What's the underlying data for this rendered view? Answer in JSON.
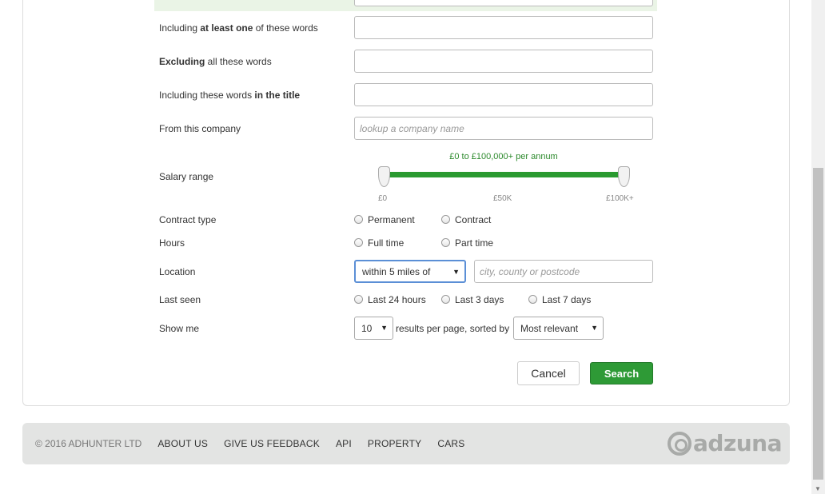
{
  "form": {
    "at_least_one": {
      "prefix": "Including ",
      "bold": "at least one",
      "suffix": " of these words"
    },
    "excluding": {
      "bold": "Excluding",
      "suffix": " all these words"
    },
    "in_title": {
      "prefix": "Including these words ",
      "bold": "in the title"
    },
    "company": {
      "label": "From this company",
      "placeholder": "lookup a company name"
    },
    "salary": {
      "label": "Salary range",
      "summary": "£0 to £100,000+ per annum",
      "ticks": [
        "£0",
        "£50K",
        "£100K+"
      ],
      "min_fraction": 0,
      "max_fraction": 1
    },
    "contract": {
      "label": "Contract type",
      "options": [
        "Permanent",
        "Contract"
      ]
    },
    "hours": {
      "label": "Hours",
      "options": [
        "Full time",
        "Part time"
      ]
    },
    "location": {
      "label": "Location",
      "radius": "within 5 miles of",
      "placeholder": "city, county or postcode"
    },
    "last_seen": {
      "label": "Last seen",
      "options": [
        "Last 24 hours",
        "Last 3 days",
        "Last 7 days"
      ]
    },
    "show_me": {
      "label": "Show me",
      "per_page": "10",
      "middle_text": "results per page, sorted by",
      "sort": "Most relevant"
    },
    "cancel_label": "Cancel",
    "search_label": "Search"
  },
  "footer": {
    "copyright": "© 2016 ADHUNTER LTD",
    "links": [
      "ABOUT US",
      "GIVE US FEEDBACK",
      "API",
      "PROPERTY",
      "CARS"
    ],
    "logo_text": "adzuna"
  },
  "colors": {
    "accent": "#2e9a36",
    "footer_bg": "#e3e4e3"
  }
}
